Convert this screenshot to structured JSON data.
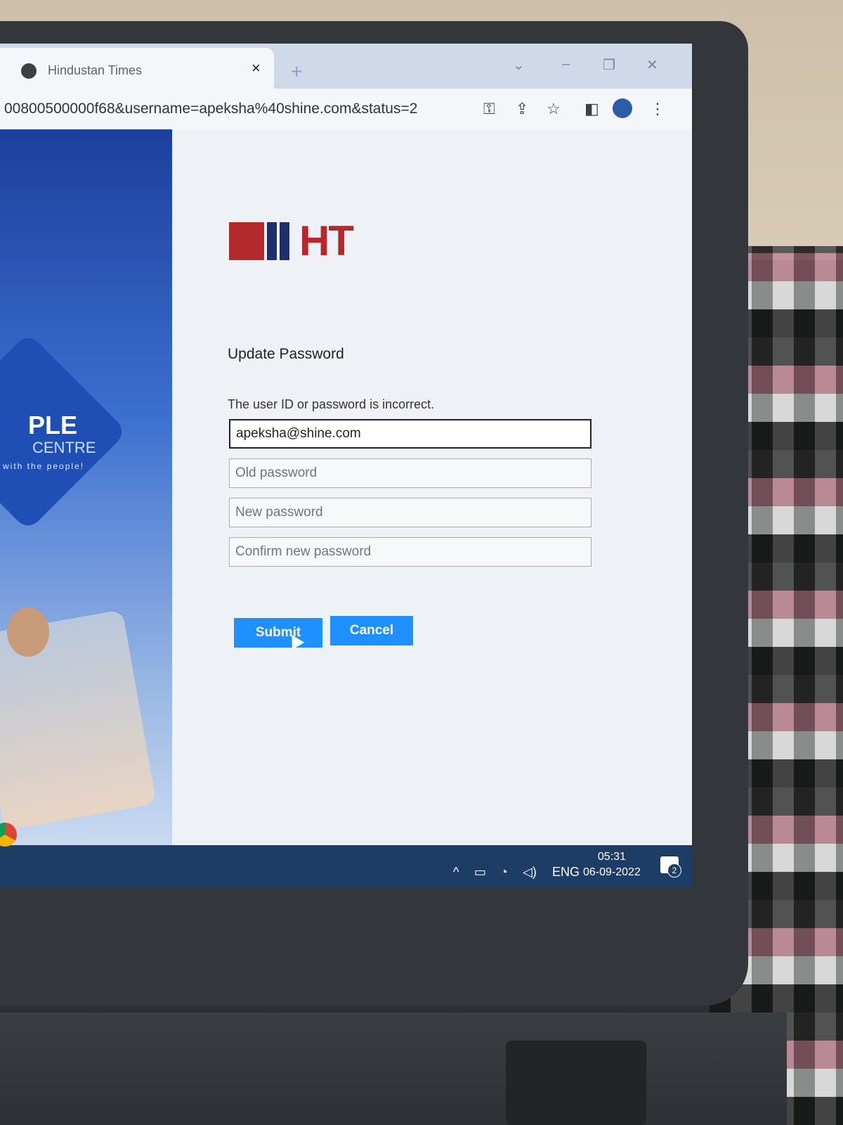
{
  "browser": {
    "tab_title": "Hindustan Times",
    "tab_close": "×",
    "new_tab": "+",
    "url": "00800500000f68&username=apeksha%40shine.com&status=2"
  },
  "sidebar_brand": {
    "ple": "PLE",
    "centre": "CENTRE",
    "tagline": "with the people!"
  },
  "logo": {
    "text": "HT"
  },
  "form": {
    "title": "Update Password",
    "error": "The user ID or password is incorrect.",
    "username_value": "apeksha@shine.com",
    "old_password_placeholder": "Old password",
    "new_password_placeholder": "New password",
    "confirm_password_placeholder": "Confirm new password",
    "submit_label": "Submit",
    "cancel_label": "Cancel"
  },
  "taskbar": {
    "language": "ENG",
    "time": "05:31",
    "date": "06-09-2022",
    "notification_count": "2"
  },
  "colors": {
    "button": "#1e90ff",
    "logo_red": "#b3292c",
    "logo_blue": "#1f2f6b",
    "taskbar": "#1d3d66"
  }
}
